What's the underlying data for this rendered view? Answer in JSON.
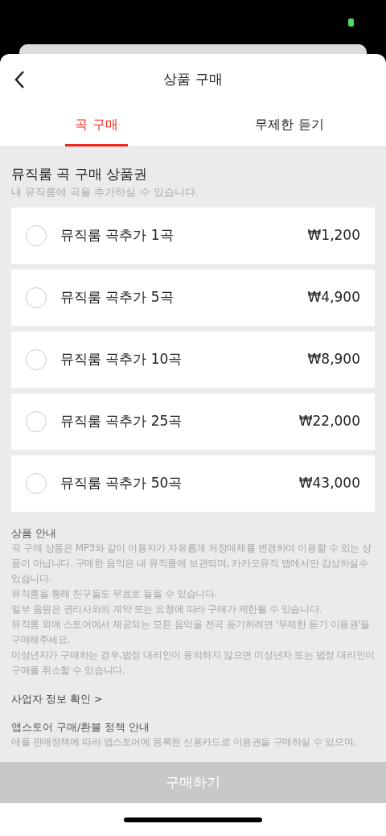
{
  "header": {
    "title": "상품 구매"
  },
  "tabs": [
    {
      "label": "곡 구매",
      "selected": true
    },
    {
      "label": "무제한 듣기",
      "selected": false
    }
  ],
  "section": {
    "title": "뮤직룸 곡 구매 상품권",
    "subtitle": "내 뮤직룸에 곡을 추가하실 수 있습니다."
  },
  "products": [
    {
      "name": "뮤직룸 곡추가 1곡",
      "price": "₩1,200",
      "selected": false
    },
    {
      "name": "뮤직룸 곡추가 5곡",
      "price": "₩4,900",
      "selected": false
    },
    {
      "name": "뮤직룸 곡추가 10곡",
      "price": "₩8,900",
      "selected": false
    },
    {
      "name": "뮤직룸 곡추가 25곡",
      "price": "₩22,000",
      "selected": false
    },
    {
      "name": "뮤직룸 곡추가 50곡",
      "price": "₩43,000",
      "selected": false
    }
  ],
  "notice": {
    "title": "상품 안내",
    "paragraphs": [
      "곡 구매 상품은 MP3와 같이 이용자가 자유롭게 저장매체를 변경하여 이용할 수 있는 상품이 아닙니다. 구매한 음악은 내 뮤직룸에 보관되며, 카카오뮤직 앱에서만 감상하실수 있습니다.",
      "뮤직룸을 통해 친구들도 무료로 들을 수 있습니다.",
      "일부 음원은 권리사와의 계약 또는 요청에 따라 구매가 제한될 수 있습니다.",
      "뮤직룸 외에 스토어에서 제공되는 모든 음악을 전곡 듣기하려면 '무제한 듣기 이용권'을 구매해주세요.",
      "미성년자가 구매하는 경우,법정 대리인이 동의하지 않으면 미성년자 또는 법정 대리인이 구매를 취소할 수 있습니다."
    ]
  },
  "business_info_link": "사업자 정보 확인 >",
  "refund": {
    "title": "앱스토어 구매/환불 정책 안내",
    "text": "애플 판매정책에 따라 앱스토어에 등록된 신용카드로 이용권을 구매하실 수 있으며,"
  },
  "purchase_button": {
    "label": "구매하기",
    "disabled": true
  }
}
